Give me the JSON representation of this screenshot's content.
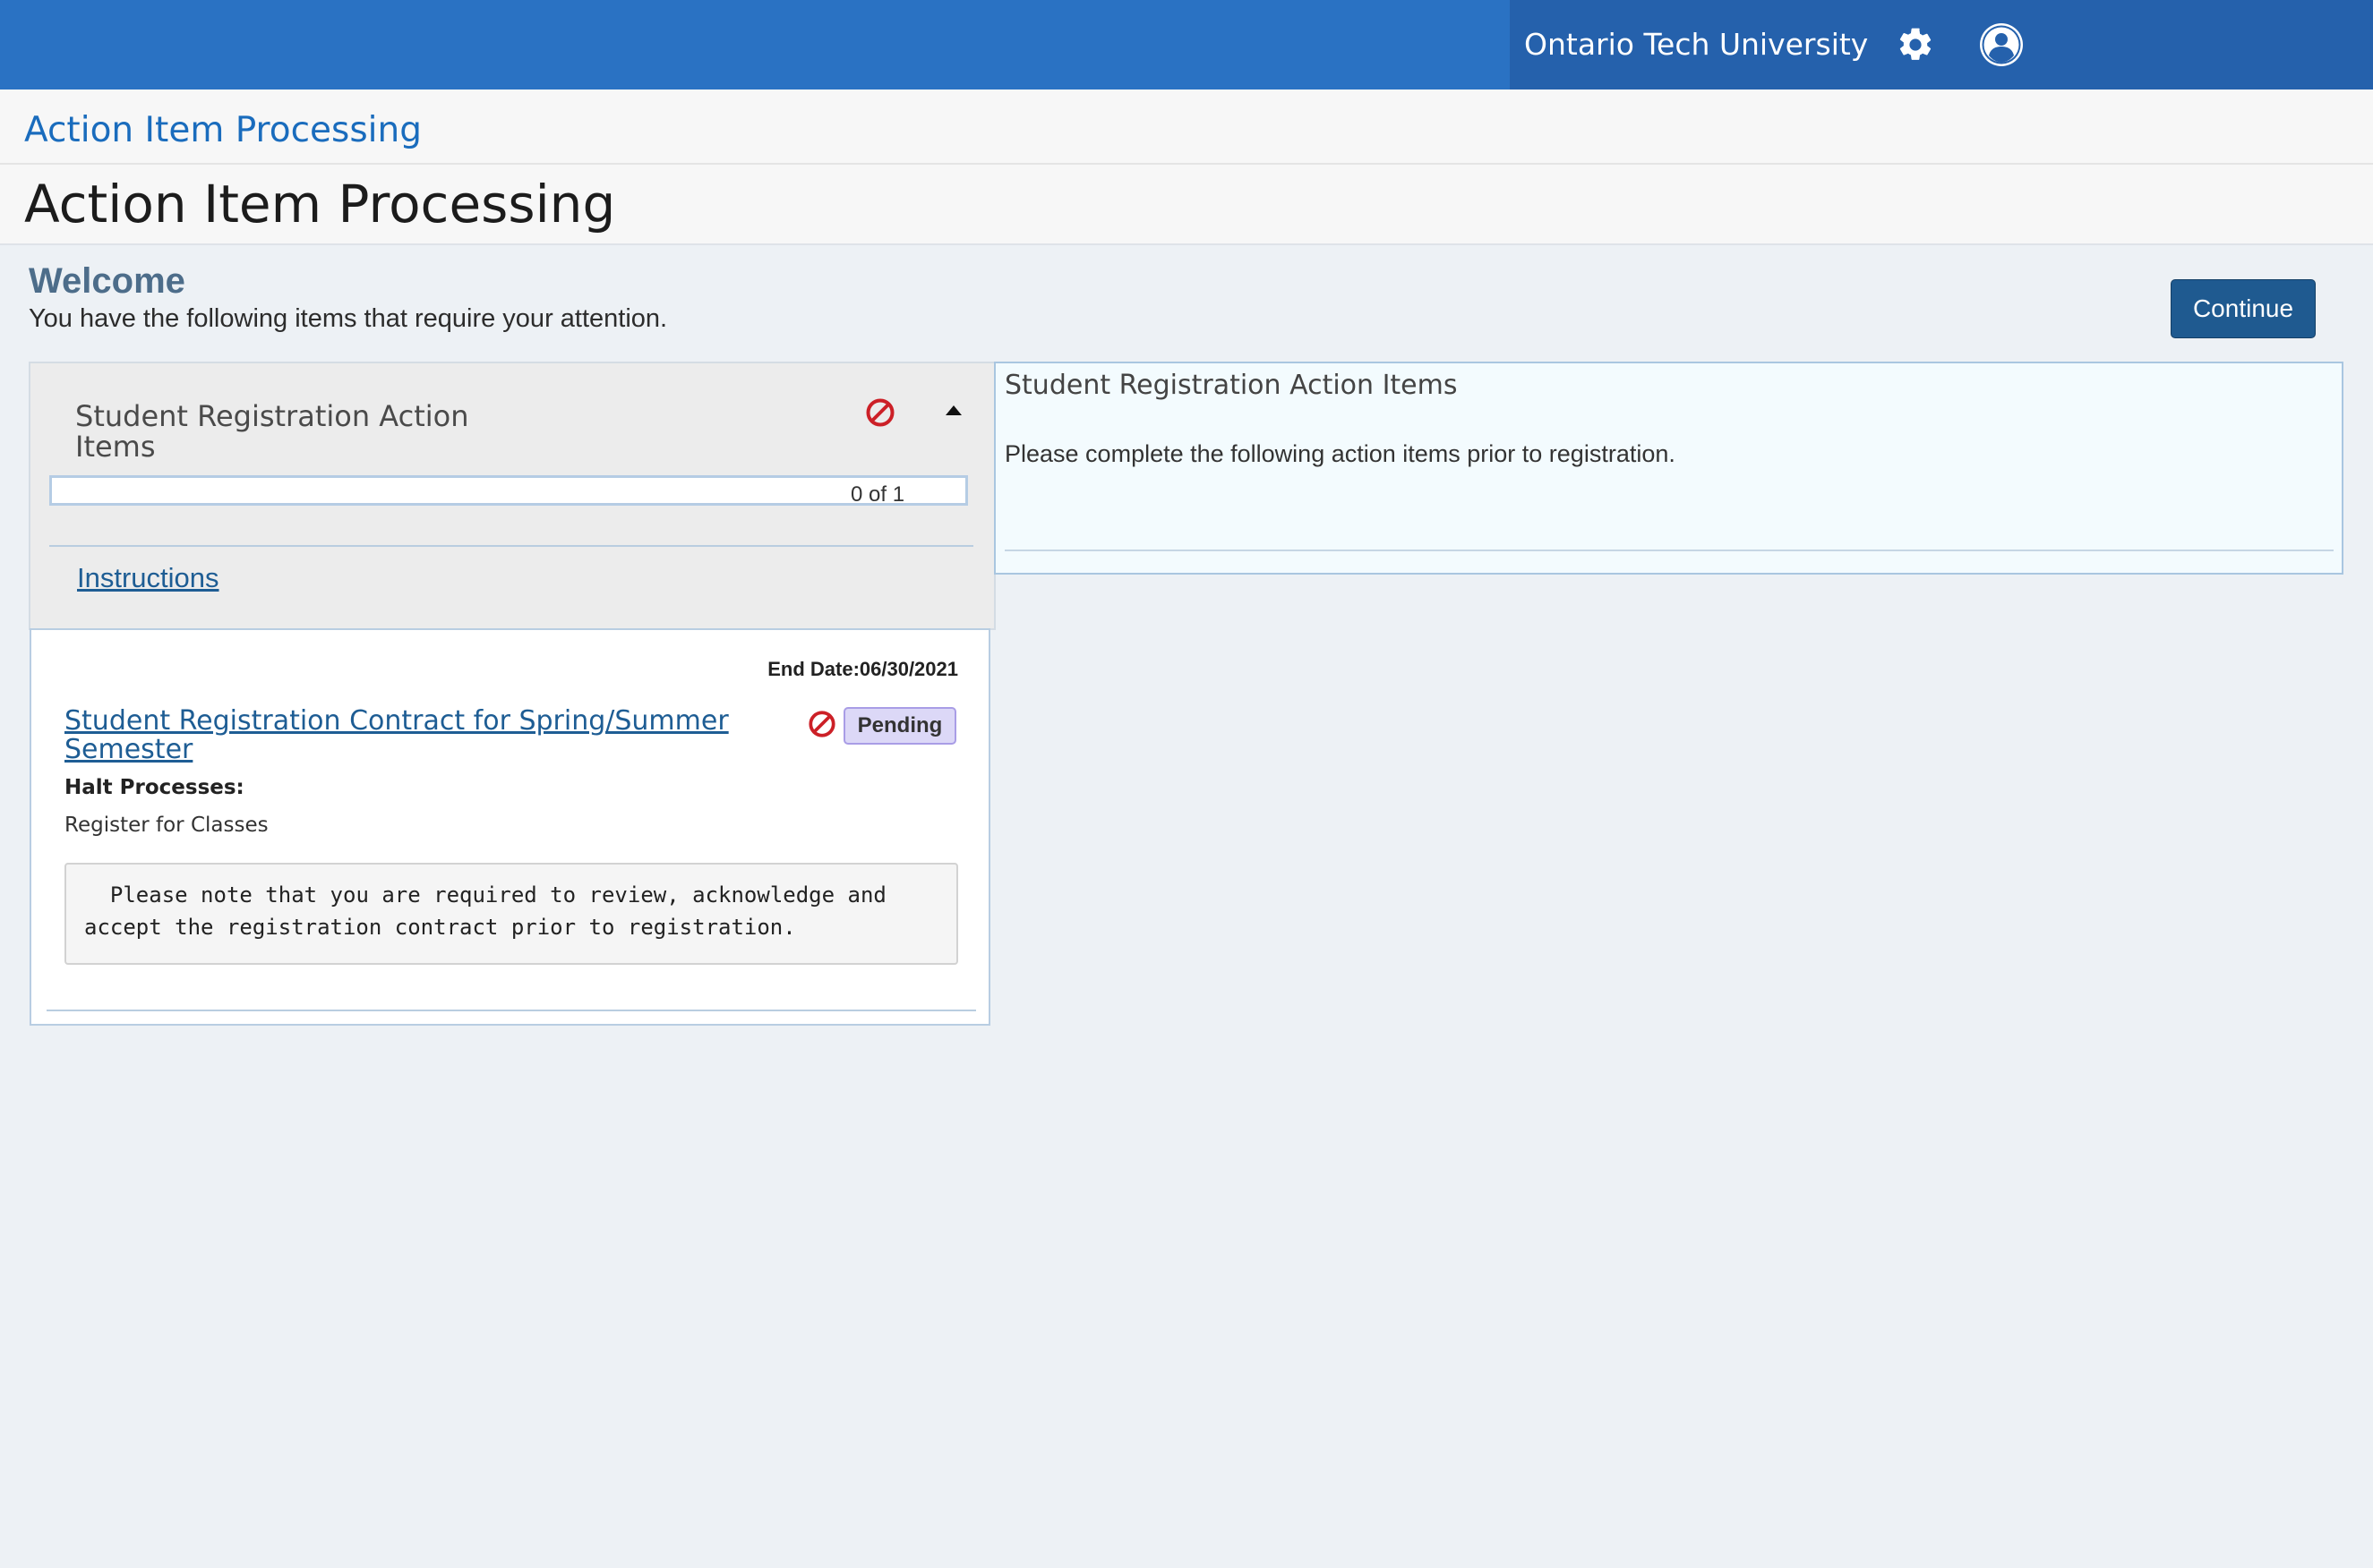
{
  "header": {
    "institution": "Ontario Tech University",
    "settings_icon": "gear-icon",
    "profile_icon": "user-icon",
    "accent_color": "#2a72c3"
  },
  "breadcrumb": {
    "label": "Action Item Processing"
  },
  "page": {
    "title": "Action Item Processing"
  },
  "welcome": {
    "heading": "Welcome",
    "message": "You have the following items that require your attention.",
    "continue_label": "Continue"
  },
  "group": {
    "title": "Student Registration Action Items",
    "status_icon": "block-icon",
    "collapse_icon": "caret-up-icon",
    "progress": {
      "completed": 0,
      "total": 1,
      "label": "0 of  1"
    },
    "instructions_label": "Instructions"
  },
  "item": {
    "end_date": "End Date:06/30/2021",
    "title": "Student Registration Contract for Spring/Summer Semester",
    "status_icon": "block-icon",
    "status": "Pending",
    "status_color": "#dcd8f7",
    "halt_label": "Halt Processes:",
    "halt_value": "Register for Classes",
    "note": "  Please note that you are required to review, acknowledge and accept the registration contract prior to registration."
  },
  "details": {
    "title": "Student Registration Action Items",
    "text": "Please complete the following action items prior to registration."
  }
}
